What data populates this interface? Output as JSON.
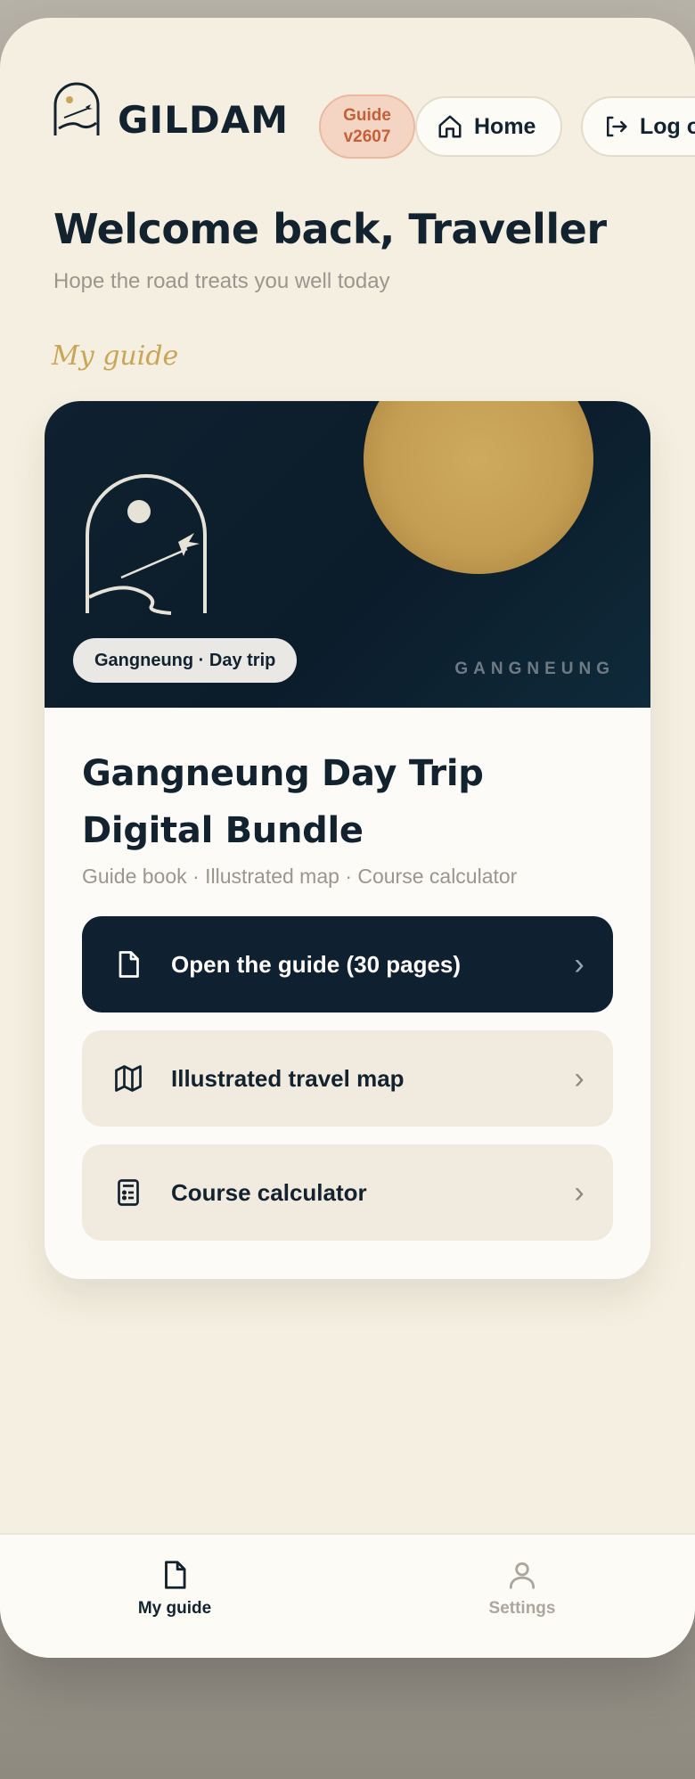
{
  "app": {
    "brand": "GILDAM",
    "version_badge": [
      "Guide",
      "v2607"
    ]
  },
  "header": {
    "home_label": "Home",
    "logout_label": "Log out"
  },
  "welcome": {
    "title": "Welcome back, Traveller",
    "subtitle": "Hope the road treats you well today"
  },
  "section": {
    "label": "My guide"
  },
  "card": {
    "hero_tag": "Gangneung · Day trip",
    "hero_city": "GANGNEUNG",
    "title_line1": "Gangneung Day Trip",
    "title_line2": "Digital Bundle",
    "subtitle": "Guide book · Illustrated map · Course calculator",
    "actions": [
      {
        "label": "Open the guide (30 pages)",
        "icon": "document-icon",
        "chevron": "›"
      },
      {
        "label": "Illustrated travel map",
        "icon": "map-icon",
        "chevron": "›"
      },
      {
        "label": "Course calculator",
        "icon": "calculator-icon",
        "chevron": "›"
      }
    ]
  },
  "tabbar": {
    "items": [
      {
        "label": "My guide",
        "icon": "document-icon",
        "active": true
      },
      {
        "label": "Settings",
        "icon": "user-icon",
        "active": false
      }
    ]
  },
  "colors": {
    "background": "#f5efe1",
    "navy": "#0f2130",
    "gold": "#c9a556",
    "badge_text": "#c2603a",
    "badge_bg": "#f4d5c4"
  }
}
